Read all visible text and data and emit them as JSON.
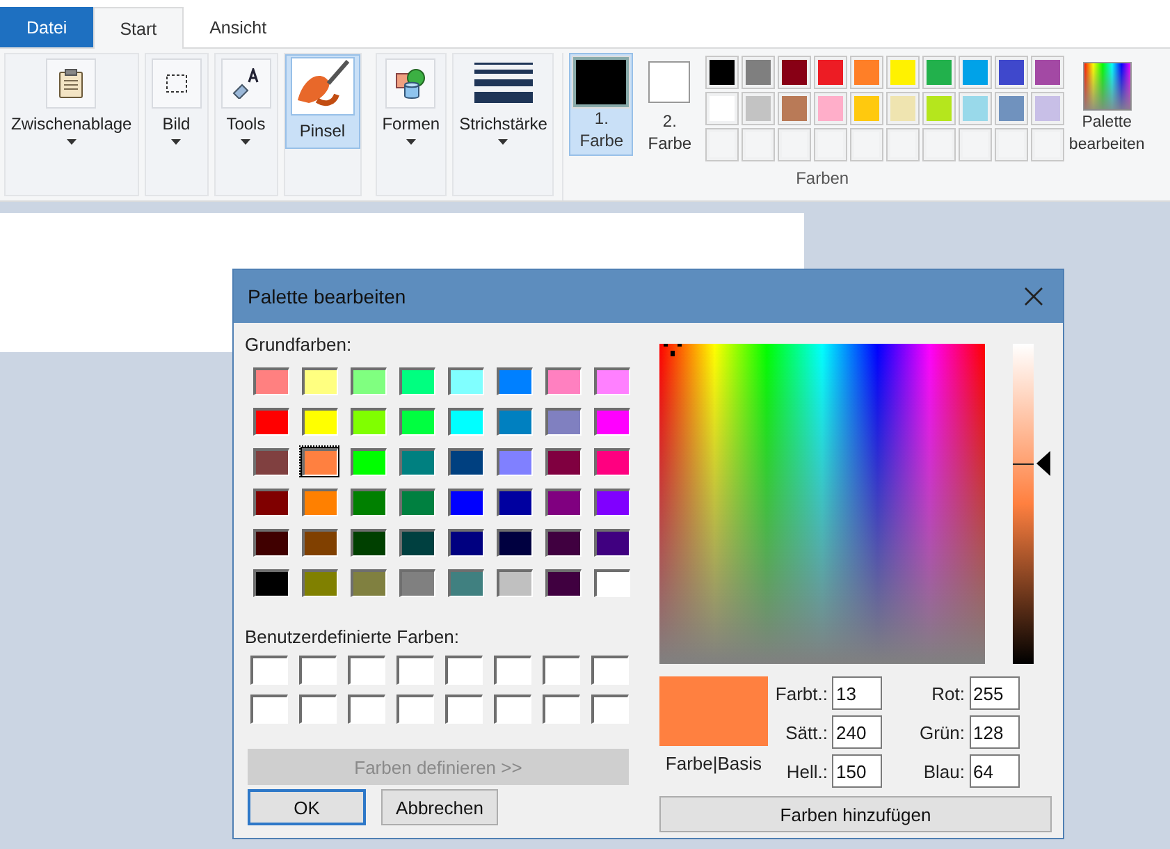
{
  "tabs": [
    {
      "label": "Datei",
      "kind": "file",
      "selected": false
    },
    {
      "label": "Start",
      "kind": "tab",
      "selected": true
    },
    {
      "label": "Ansicht",
      "kind": "tab",
      "selected": false
    }
  ],
  "ribbon": {
    "groups": [
      {
        "label": "Zwischenablage",
        "selected": false
      },
      {
        "label": "Bild",
        "selected": false
      },
      {
        "label": "Tools",
        "selected": false
      },
      {
        "label": "Pinsel",
        "selected": true
      },
      {
        "label": "Formen",
        "selected": false
      },
      {
        "label": "Strichstärke",
        "selected": false
      }
    ],
    "color_slots": [
      {
        "number": "1.",
        "label": "Farbe",
        "color": "#000000",
        "selected": true
      },
      {
        "number": "2.",
        "label": "Farbe",
        "color": "#ffffff",
        "selected": false
      }
    ],
    "palette": [
      {
        "color": "#000000"
      },
      {
        "color": "#7f7f7f"
      },
      {
        "color": "#880015"
      },
      {
        "color": "#ed1c24"
      },
      {
        "color": "#ff7f27"
      },
      {
        "color": "#fff200"
      },
      {
        "color": "#22b14c"
      },
      {
        "color": "#00a2e8"
      },
      {
        "color": "#3f48cc"
      },
      {
        "color": "#a349a4"
      },
      {
        "color": "#ffffff"
      },
      {
        "color": "#c3c3c3"
      },
      {
        "color": "#b97a57"
      },
      {
        "color": "#ffaec9"
      },
      {
        "color": "#ffc90e"
      },
      {
        "color": "#efe4b0"
      },
      {
        "color": "#b5e61d"
      },
      {
        "color": "#99d9ea"
      },
      {
        "color": "#7092be"
      },
      {
        "color": "#c8bfe7"
      },
      {
        "color": "#f4f5f6"
      },
      {
        "color": "#f4f5f6"
      },
      {
        "color": "#f4f5f6"
      },
      {
        "color": "#f4f5f6"
      },
      {
        "color": "#f4f5f6"
      },
      {
        "color": "#f4f5f6"
      },
      {
        "color": "#f4f5f6"
      },
      {
        "color": "#f4f5f6"
      },
      {
        "color": "#f4f5f6"
      },
      {
        "color": "#f4f5f6"
      }
    ],
    "edit_palette": {
      "line1": "Palette",
      "line2": "bearbeiten"
    },
    "colors_group_label": "Farben"
  },
  "dialog": {
    "title": "Palette bearbeiten",
    "basic_label": "Grundfarben:",
    "basic_colors": [
      {
        "color": "#ff8080",
        "selected": false
      },
      {
        "color": "#ffff80",
        "selected": false
      },
      {
        "color": "#80ff80",
        "selected": false
      },
      {
        "color": "#00ff80",
        "selected": false
      },
      {
        "color": "#80ffff",
        "selected": false
      },
      {
        "color": "#0080ff",
        "selected": false
      },
      {
        "color": "#ff80c0",
        "selected": false
      },
      {
        "color": "#ff80ff",
        "selected": false
      },
      {
        "color": "#ff0000",
        "selected": false
      },
      {
        "color": "#ffff00",
        "selected": false
      },
      {
        "color": "#80ff00",
        "selected": false
      },
      {
        "color": "#00ff40",
        "selected": false
      },
      {
        "color": "#00ffff",
        "selected": false
      },
      {
        "color": "#0080c0",
        "selected": false
      },
      {
        "color": "#8080c0",
        "selected": false
      },
      {
        "color": "#ff00ff",
        "selected": false
      },
      {
        "color": "#804040",
        "selected": false
      },
      {
        "color": "#ff8040",
        "selected": true
      },
      {
        "color": "#00ff00",
        "selected": false
      },
      {
        "color": "#008080",
        "selected": false
      },
      {
        "color": "#004080",
        "selected": false
      },
      {
        "color": "#8080ff",
        "selected": false
      },
      {
        "color": "#800040",
        "selected": false
      },
      {
        "color": "#ff0080",
        "selected": false
      },
      {
        "color": "#800000",
        "selected": false
      },
      {
        "color": "#ff8000",
        "selected": false
      },
      {
        "color": "#008000",
        "selected": false
      },
      {
        "color": "#008040",
        "selected": false
      },
      {
        "color": "#0000ff",
        "selected": false
      },
      {
        "color": "#0000a0",
        "selected": false
      },
      {
        "color": "#800080",
        "selected": false
      },
      {
        "color": "#8000ff",
        "selected": false
      },
      {
        "color": "#400000",
        "selected": false
      },
      {
        "color": "#804000",
        "selected": false
      },
      {
        "color": "#004000",
        "selected": false
      },
      {
        "color": "#004040",
        "selected": false
      },
      {
        "color": "#000080",
        "selected": false
      },
      {
        "color": "#000040",
        "selected": false
      },
      {
        "color": "#400040",
        "selected": false
      },
      {
        "color": "#400080",
        "selected": false
      },
      {
        "color": "#000000",
        "selected": false
      },
      {
        "color": "#808000",
        "selected": false
      },
      {
        "color": "#808040",
        "selected": false
      },
      {
        "color": "#808080",
        "selected": false
      },
      {
        "color": "#408080",
        "selected": false
      },
      {
        "color": "#c0c0c0",
        "selected": false
      },
      {
        "color": "#400040",
        "selected": false
      },
      {
        "color": "#ffffff",
        "selected": false
      }
    ],
    "custom_label": "Benutzerdefinierte Farben:",
    "custom_colors": [
      {
        "color": "#ffffff"
      },
      {
        "color": "#ffffff"
      },
      {
        "color": "#ffffff"
      },
      {
        "color": "#ffffff"
      },
      {
        "color": "#ffffff"
      },
      {
        "color": "#ffffff"
      },
      {
        "color": "#ffffff"
      },
      {
        "color": "#ffffff"
      },
      {
        "color": "#ffffff"
      },
      {
        "color": "#ffffff"
      },
      {
        "color": "#ffffff"
      },
      {
        "color": "#ffffff"
      },
      {
        "color": "#ffffff"
      },
      {
        "color": "#ffffff"
      },
      {
        "color": "#ffffff"
      },
      {
        "color": "#ffffff"
      }
    ],
    "define_button": {
      "label": "Farben definieren >>",
      "disabled": true
    },
    "ok_button": "OK",
    "cancel_button": "Abbrechen",
    "luminance": {
      "level": 0.625
    },
    "preview": {
      "color": "#ff8040",
      "label": "Farbe|Basis"
    },
    "fields": [
      {
        "label": "Farbt.:",
        "value": "13"
      },
      {
        "label": "Rot:",
        "value": "255"
      },
      {
        "label": "Sätt.:",
        "value": "240"
      },
      {
        "label": "Grün:",
        "value": "128"
      },
      {
        "label": "Hell.:",
        "value": "150"
      },
      {
        "label": "Blau:",
        "value": "64"
      }
    ],
    "add_button": "Farben hinzufügen"
  }
}
